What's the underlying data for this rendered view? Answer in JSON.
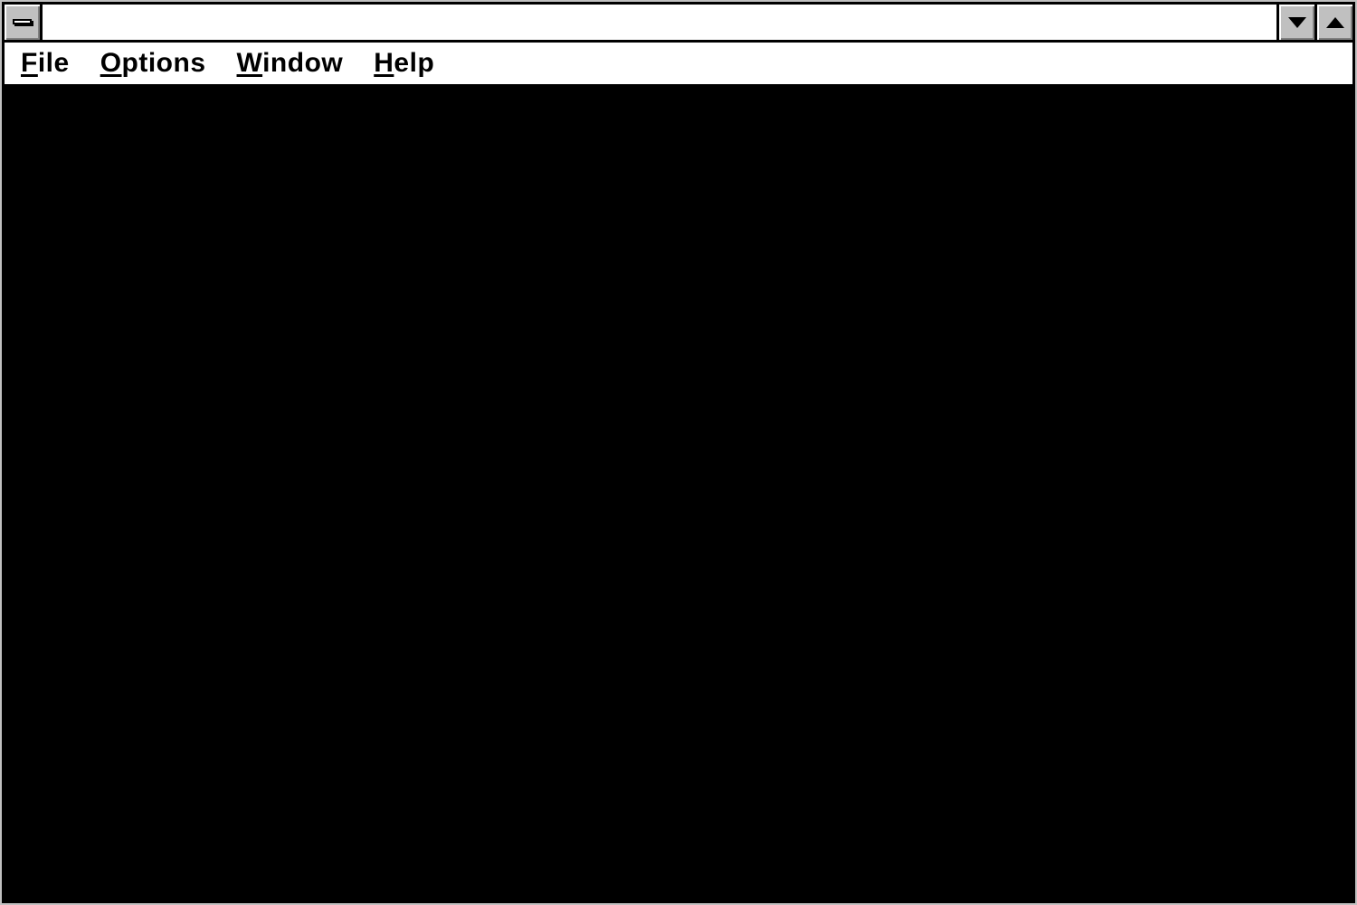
{
  "window": {
    "title": ""
  },
  "menubar": {
    "items": [
      {
        "accel": "F",
        "rest": "ile"
      },
      {
        "accel": "O",
        "rest": "ptions"
      },
      {
        "accel": "W",
        "rest": "indow"
      },
      {
        "accel": "H",
        "rest": "elp"
      }
    ]
  }
}
